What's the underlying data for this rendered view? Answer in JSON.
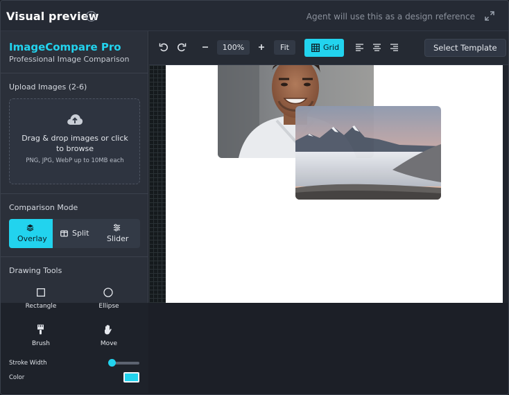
{
  "header": {
    "title": "Visual preview",
    "info_icon": "info-icon",
    "agent_note": "Agent will use this as a design reference",
    "expand_icon": "expand-icon"
  },
  "sidebar": {
    "app_name": "ImageCompare Pro",
    "app_subtitle": "Professional Image Comparison",
    "upload": {
      "label": "Upload Images (2-6)",
      "drop_text": "Drag & drop images or click to browse",
      "formats_text": "PNG, JPG, WebP up to 10MB each",
      "icon": "upload-cloud-icon"
    },
    "comparison": {
      "label": "Comparison Mode",
      "modes": [
        {
          "label": "Overlay",
          "icon": "layers-icon",
          "active": true
        },
        {
          "label": "Split",
          "icon": "split-view-icon",
          "active": false
        },
        {
          "label": "Slider",
          "icon": "sliders-icon",
          "active": false
        }
      ]
    },
    "drawing": {
      "label": "Drawing Tools",
      "tools": [
        {
          "label": "Rectangle",
          "icon": "rectangle-icon"
        },
        {
          "label": "Ellipse",
          "icon": "ellipse-icon"
        },
        {
          "label": "Brush",
          "icon": "brush-icon"
        },
        {
          "label": "Move",
          "icon": "hand-icon"
        }
      ],
      "stroke_width_label": "Stroke Width",
      "stroke_width_level": 0.1,
      "color_label": "Color",
      "color_value": "#22d3ee"
    }
  },
  "toolbar": {
    "undo_icon": "undo-icon",
    "redo_icon": "redo-icon",
    "zoom_out_icon": "minus-icon",
    "zoom_level": "100%",
    "zoom_in_icon": "plus-icon",
    "fit_label": "Fit",
    "grid_label": "Grid",
    "grid_active": true,
    "align_icons": [
      "align-left-icon",
      "align-center-icon",
      "align-right-icon"
    ],
    "template_label": "Select Template"
  },
  "canvas": {
    "images": [
      {
        "name": "portrait-photo",
        "description_icon": "portrait-photo"
      },
      {
        "name": "mountain-photo",
        "description_icon": "mountain-photo"
      }
    ]
  },
  "colors": {
    "accent": "#22d3ee",
    "panel": "#2b303a",
    "canvas": "#ffffff"
  }
}
